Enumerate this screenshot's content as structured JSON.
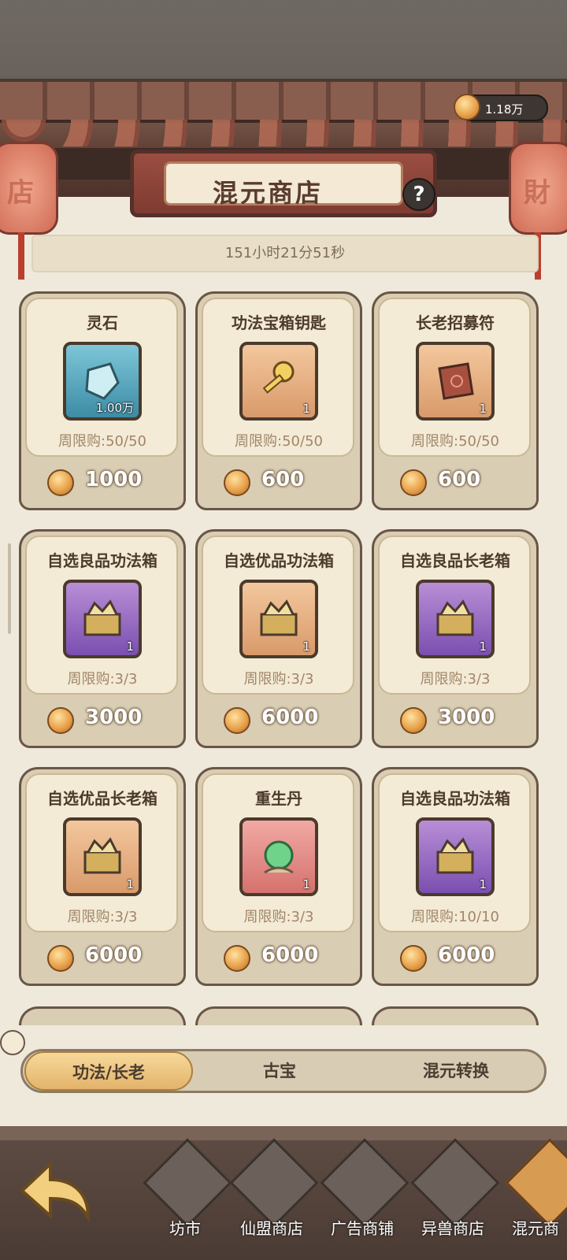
{
  "header": {
    "currency_amount": "1.18万",
    "title": "混元商店",
    "help_symbol": "?",
    "timer": "151小时21分51秒",
    "lantern_left_char": "店",
    "lantern_right_char": "財"
  },
  "items": [
    {
      "name": "灵石",
      "qty": "1.00万",
      "limit": "周限购:50/50",
      "price": "1000",
      "icon": "spirit-stone-icon"
    },
    {
      "name": "功法宝箱钥匙",
      "qty": "1",
      "limit": "周限购:50/50",
      "price": "600",
      "icon": "golden-key-icon"
    },
    {
      "name": "长老招募符",
      "qty": "1",
      "limit": "周限购:50/50",
      "price": "600",
      "icon": "talisman-scroll-icon"
    },
    {
      "name": "自选良品功法箱",
      "qty": "1",
      "limit": "周限购:3/3",
      "price": "3000",
      "icon": "technique-chest-icon"
    },
    {
      "name": "自选优品功法箱",
      "qty": "1",
      "limit": "周限购:3/3",
      "price": "6000",
      "icon": "technique-chest-icon"
    },
    {
      "name": "自选良品长老箱",
      "qty": "1",
      "limit": "周限购:3/3",
      "price": "3000",
      "icon": "elder-chest-icon"
    },
    {
      "name": "自选优品长老箱",
      "qty": "1",
      "limit": "周限购:3/3",
      "price": "6000",
      "icon": "elder-chest-icon"
    },
    {
      "name": "重生丹",
      "qty": "1",
      "limit": "周限购:3/3",
      "price": "6000",
      "icon": "rebirth-pill-icon"
    },
    {
      "name": "自选良品功法箱",
      "qty": "1",
      "limit": "周限购:10/10",
      "price": "6000",
      "icon": "technique-chest-icon"
    }
  ],
  "tabs": [
    {
      "label": "功法/长老",
      "active": true
    },
    {
      "label": "古宝",
      "active": false
    },
    {
      "label": "混元转换",
      "active": false
    }
  ],
  "nav": [
    {
      "label": "坊市"
    },
    {
      "label": "仙盟商店"
    },
    {
      "label": "广告商铺"
    },
    {
      "label": "异兽商店"
    },
    {
      "label": "混元商"
    }
  ]
}
